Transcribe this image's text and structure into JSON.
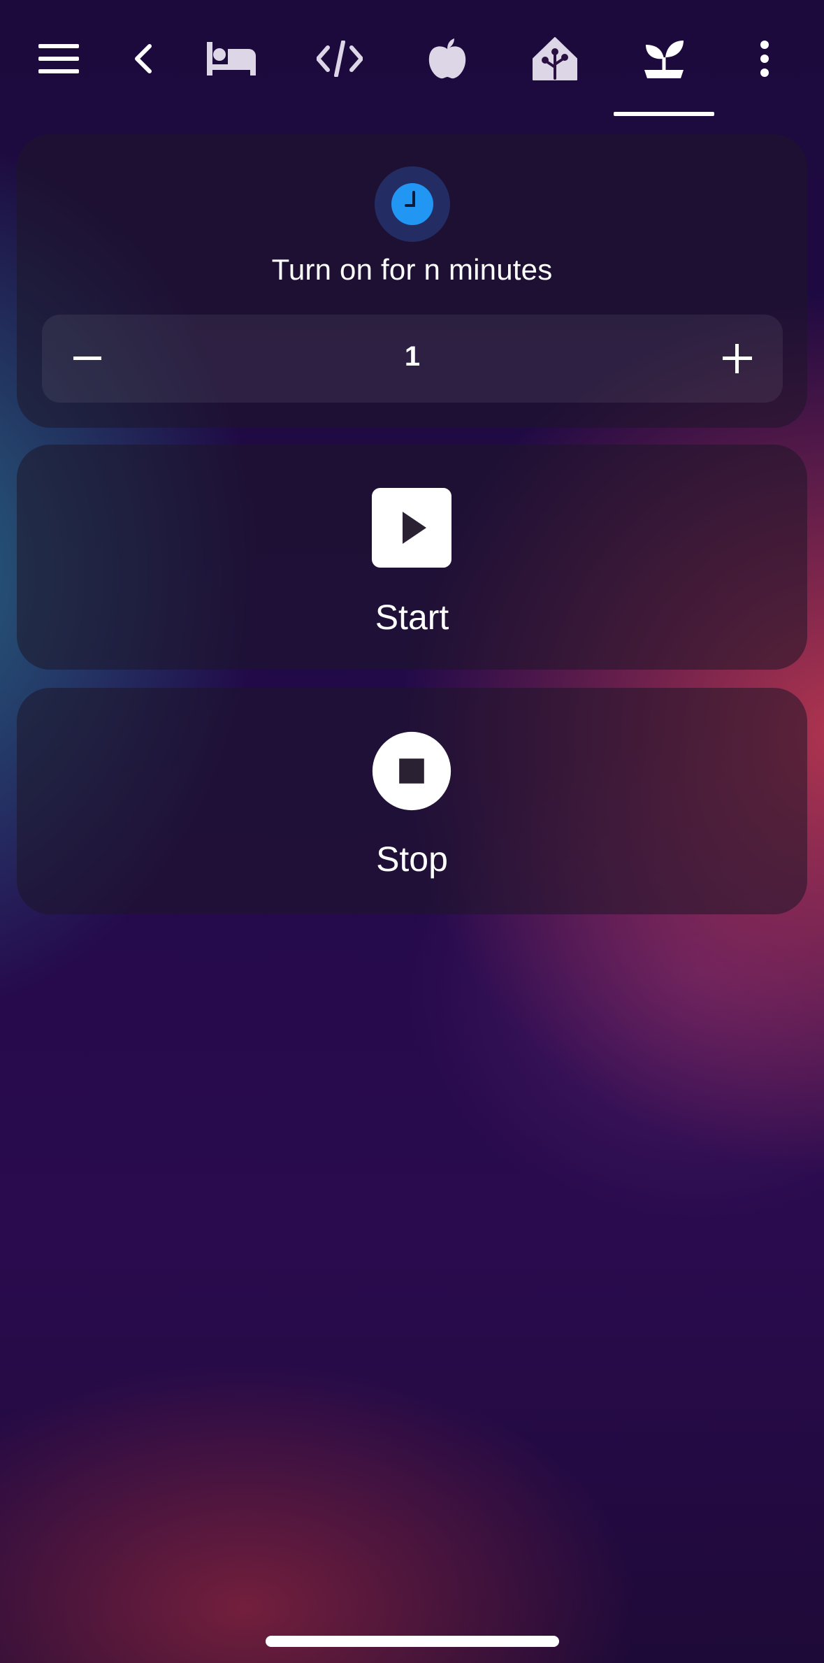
{
  "toolbar": {
    "items": [
      {
        "icon": "menu-icon"
      },
      {
        "icon": "chevron-left-icon"
      },
      {
        "icon": "bed-icon"
      },
      {
        "icon": "code-icon"
      },
      {
        "icon": "apple-icon"
      },
      {
        "icon": "home-assistant-icon"
      },
      {
        "icon": "sprout-icon",
        "active": true
      },
      {
        "icon": "more-vertical-icon"
      }
    ]
  },
  "timer_card": {
    "icon": "clock-icon",
    "title": "Turn on for n minutes",
    "value": "1",
    "decrement_icon": "minus-icon",
    "increment_icon": "plus-icon",
    "accent_color": "#2196f3"
  },
  "start_card": {
    "icon": "play-box-icon",
    "label": "Start"
  },
  "stop_card": {
    "icon": "stop-circle-icon",
    "label": "Stop"
  },
  "colors": {
    "icon_inactive": "#ddd6e6",
    "icon_active": "#ffffff"
  }
}
